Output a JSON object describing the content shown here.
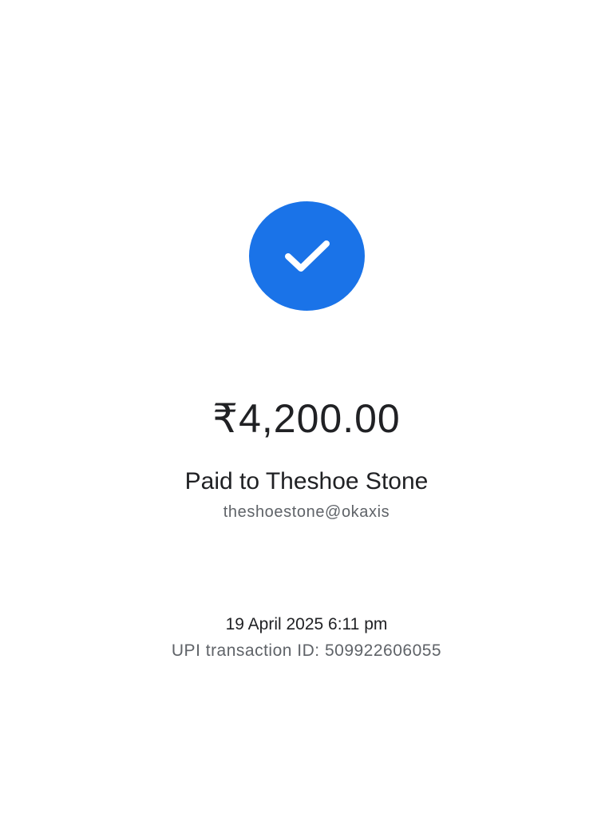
{
  "status": {
    "icon": "check-circle-icon",
    "color": "#1a73e8"
  },
  "payment": {
    "amount": "₹4,200.00",
    "paid_to_label": "Paid to Theshoe Stone",
    "payee_upi_id": "theshoestone@okaxis",
    "datetime": "19 April 2025 6:11 pm",
    "transaction_id_label": "UPI transaction ID: 509922606055"
  }
}
